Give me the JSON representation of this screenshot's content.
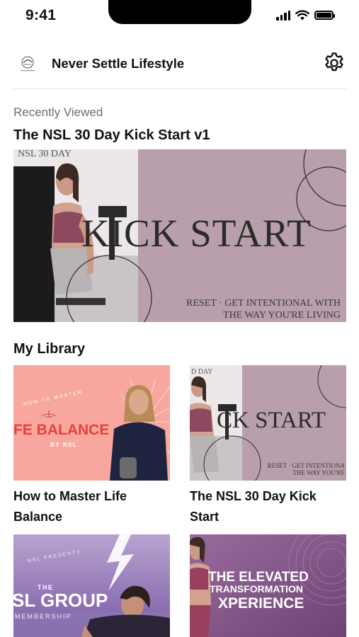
{
  "status_bar": {
    "time": "9:41"
  },
  "header": {
    "title": "Never Settle Lifestyle"
  },
  "recently_viewed": {
    "caption": "Recently Viewed",
    "title": "The NSL 30 Day Kick Start v1",
    "image": {
      "top_text": "NSL 30 DAY",
      "main_text": "KICK START",
      "sub_line1": "RESET · GET INTENTIONAL WITH",
      "sub_line2": "THE WAY YOU'RE LIVING"
    }
  },
  "library": {
    "title": "My Library",
    "items": [
      {
        "title": "How to Master Life Balance",
        "image": {
          "arc_text": "HOW TO MASTER",
          "main_text": "FE BALANCE",
          "by_text": "BY NSL"
        }
      },
      {
        "title": "The NSL 30 Day Kick Start",
        "image": {
          "top_text": "D DAY",
          "main_text": "CK START",
          "sub_line1": "RESET · GET INTENTIONA",
          "sub_line2": "THE WAY YOU'RE"
        }
      },
      {
        "title": "",
        "image": {
          "arc_text": "NSL PRESENTS",
          "small_text": "THE",
          "main_text": "SL GROUP",
          "sub_text": "MEMBERSHIP"
        }
      },
      {
        "title": "",
        "image": {
          "line1": "THE ELEVATED",
          "line2": "TRANSFORMATION",
          "line3": "XPERIENCE"
        }
      }
    ]
  },
  "colors": {
    "mauve": "#b89fab",
    "salmon": "#f7a79d",
    "balance_red": "#e8413c",
    "purple": "#8f5f95",
    "lavender": "#b8a3cf"
  },
  "icons": {
    "settings": "gear-icon",
    "wifi": "wifi-icon",
    "signal": "cellular-signal-icon",
    "battery": "battery-icon"
  }
}
